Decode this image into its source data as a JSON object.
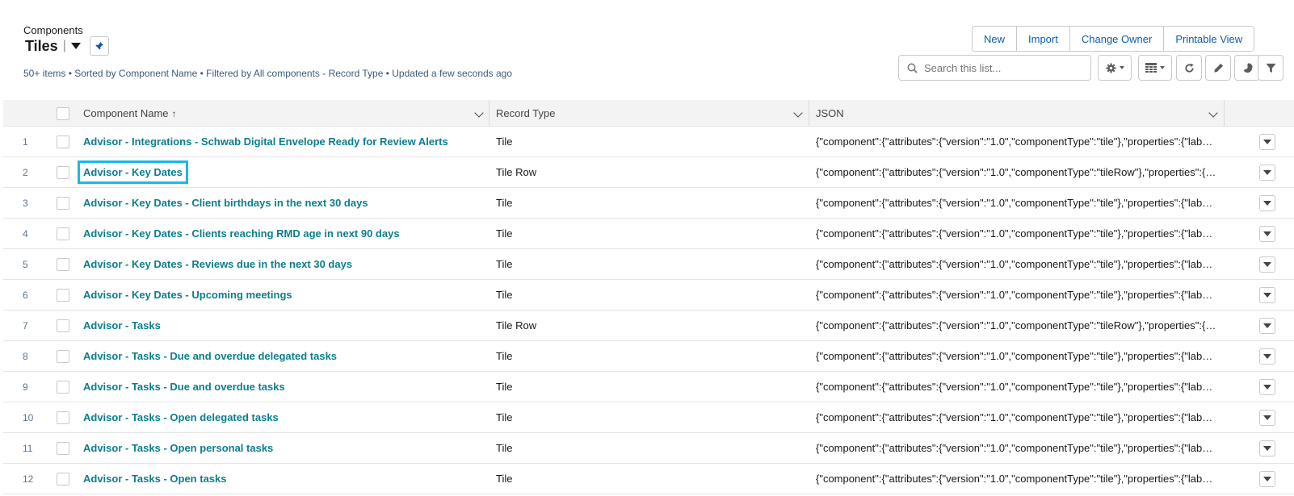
{
  "header": {
    "object_label": "Components",
    "list_title": "Tiles",
    "title_separator": "|",
    "meta": "50+ items • Sorted by Component Name • Filtered by All components - Record Type • Updated a few seconds ago"
  },
  "actions": {
    "new": "New",
    "import": "Import",
    "change_owner": "Change Owner",
    "printable_view": "Printable View"
  },
  "search": {
    "placeholder": "Search this list..."
  },
  "toolbar_icons": [
    "gear-icon",
    "table-icon",
    "refresh-icon",
    "pencil-icon",
    "chart-icon",
    "filter-icon"
  ],
  "table": {
    "columns": {
      "name": "Component Name",
      "name_sort": "↑",
      "record_type": "Record Type",
      "json": "JSON"
    },
    "rows": [
      {
        "num": "1",
        "name": "Advisor - Integrations - Schwab Digital Envelope Ready for Review Alerts",
        "record_type": "Tile",
        "json": "{\"component\":{\"attributes\":{\"version\":\"1.0\",\"componentType\":\"tile\"},\"properties\":{\"label\":\"Schwab Digital Envelope\"}}}"
      },
      {
        "num": "2",
        "name": "Advisor - Key Dates",
        "record_type": "Tile Row",
        "json": "{\"component\":{\"attributes\":{\"version\":\"1.0\",\"componentType\":\"tileRow\"},\"properties\":{\"label\":\"Key Dates\"}}}"
      },
      {
        "num": "3",
        "name": "Advisor - Key Dates - Client birthdays in the next 30 days",
        "record_type": "Tile",
        "json": "{\"component\":{\"attributes\":{\"version\":\"1.0\",\"componentType\":\"tile\"},\"properties\":{\"label\":\"Client birthdays\"}}}"
      },
      {
        "num": "4",
        "name": "Advisor - Key Dates - Clients reaching RMD age in next 90 days",
        "record_type": "Tile",
        "json": "{\"component\":{\"attributes\":{\"version\":\"1.0\",\"componentType\":\"tile\"},\"properties\":{\"label\":\"RMD age\"}}}"
      },
      {
        "num": "5",
        "name": "Advisor - Key Dates - Reviews due in the next 30 days",
        "record_type": "Tile",
        "json": "{\"component\":{\"attributes\":{\"version\":\"1.0\",\"componentType\":\"tile\"},\"properties\":{\"label\":\"Reviews due\"}}}"
      },
      {
        "num": "6",
        "name": "Advisor - Key Dates - Upcoming meetings",
        "record_type": "Tile",
        "json": "{\"component\":{\"attributes\":{\"version\":\"1.0\",\"componentType\":\"tile\"},\"properties\":{\"label\":\"Upcoming meetings\"}}}"
      },
      {
        "num": "7",
        "name": "Advisor - Tasks",
        "record_type": "Tile Row",
        "json": "{\"component\":{\"attributes\":{\"version\":\"1.0\",\"componentType\":\"tileRow\"},\"properties\":{\"label\":\"Tasks\"}}}"
      },
      {
        "num": "8",
        "name": "Advisor - Tasks - Due and overdue delegated tasks",
        "record_type": "Tile",
        "json": "{\"component\":{\"attributes\":{\"version\":\"1.0\",\"componentType\":\"tile\"},\"properties\":{\"label\":\"Due delegated\"}}}"
      },
      {
        "num": "9",
        "name": "Advisor - Tasks - Due and overdue tasks",
        "record_type": "Tile",
        "json": "{\"component\":{\"attributes\":{\"version\":\"1.0\",\"componentType\":\"tile\"},\"properties\":{\"label\":\"Due tasks\"}}}"
      },
      {
        "num": "10",
        "name": "Advisor - Tasks - Open delegated tasks",
        "record_type": "Tile",
        "json": "{\"component\":{\"attributes\":{\"version\":\"1.0\",\"componentType\":\"tile\"},\"properties\":{\"label\":\"Open delegated\"}}}"
      },
      {
        "num": "11",
        "name": "Advisor - Tasks - Open personal tasks",
        "record_type": "Tile",
        "json": "{\"component\":{\"attributes\":{\"version\":\"1.0\",\"componentType\":\"tile\"},\"properties\":{\"label\":\"Open personal\"}}}"
      },
      {
        "num": "12",
        "name": "Advisor - Tasks - Open tasks",
        "record_type": "Tile",
        "json": "{\"component\":{\"attributes\":{\"version\":\"1.0\",\"componentType\":\"tile\"},\"properties\":{\"label\":\"Open tasks\"}}}"
      }
    ],
    "highlighted_row": "2"
  },
  "colors": {
    "link": "#0b7e8e",
    "brand_blue": "#0b5cab",
    "highlight": "#1ab9e6",
    "header_bg": "#f3f3f3"
  }
}
